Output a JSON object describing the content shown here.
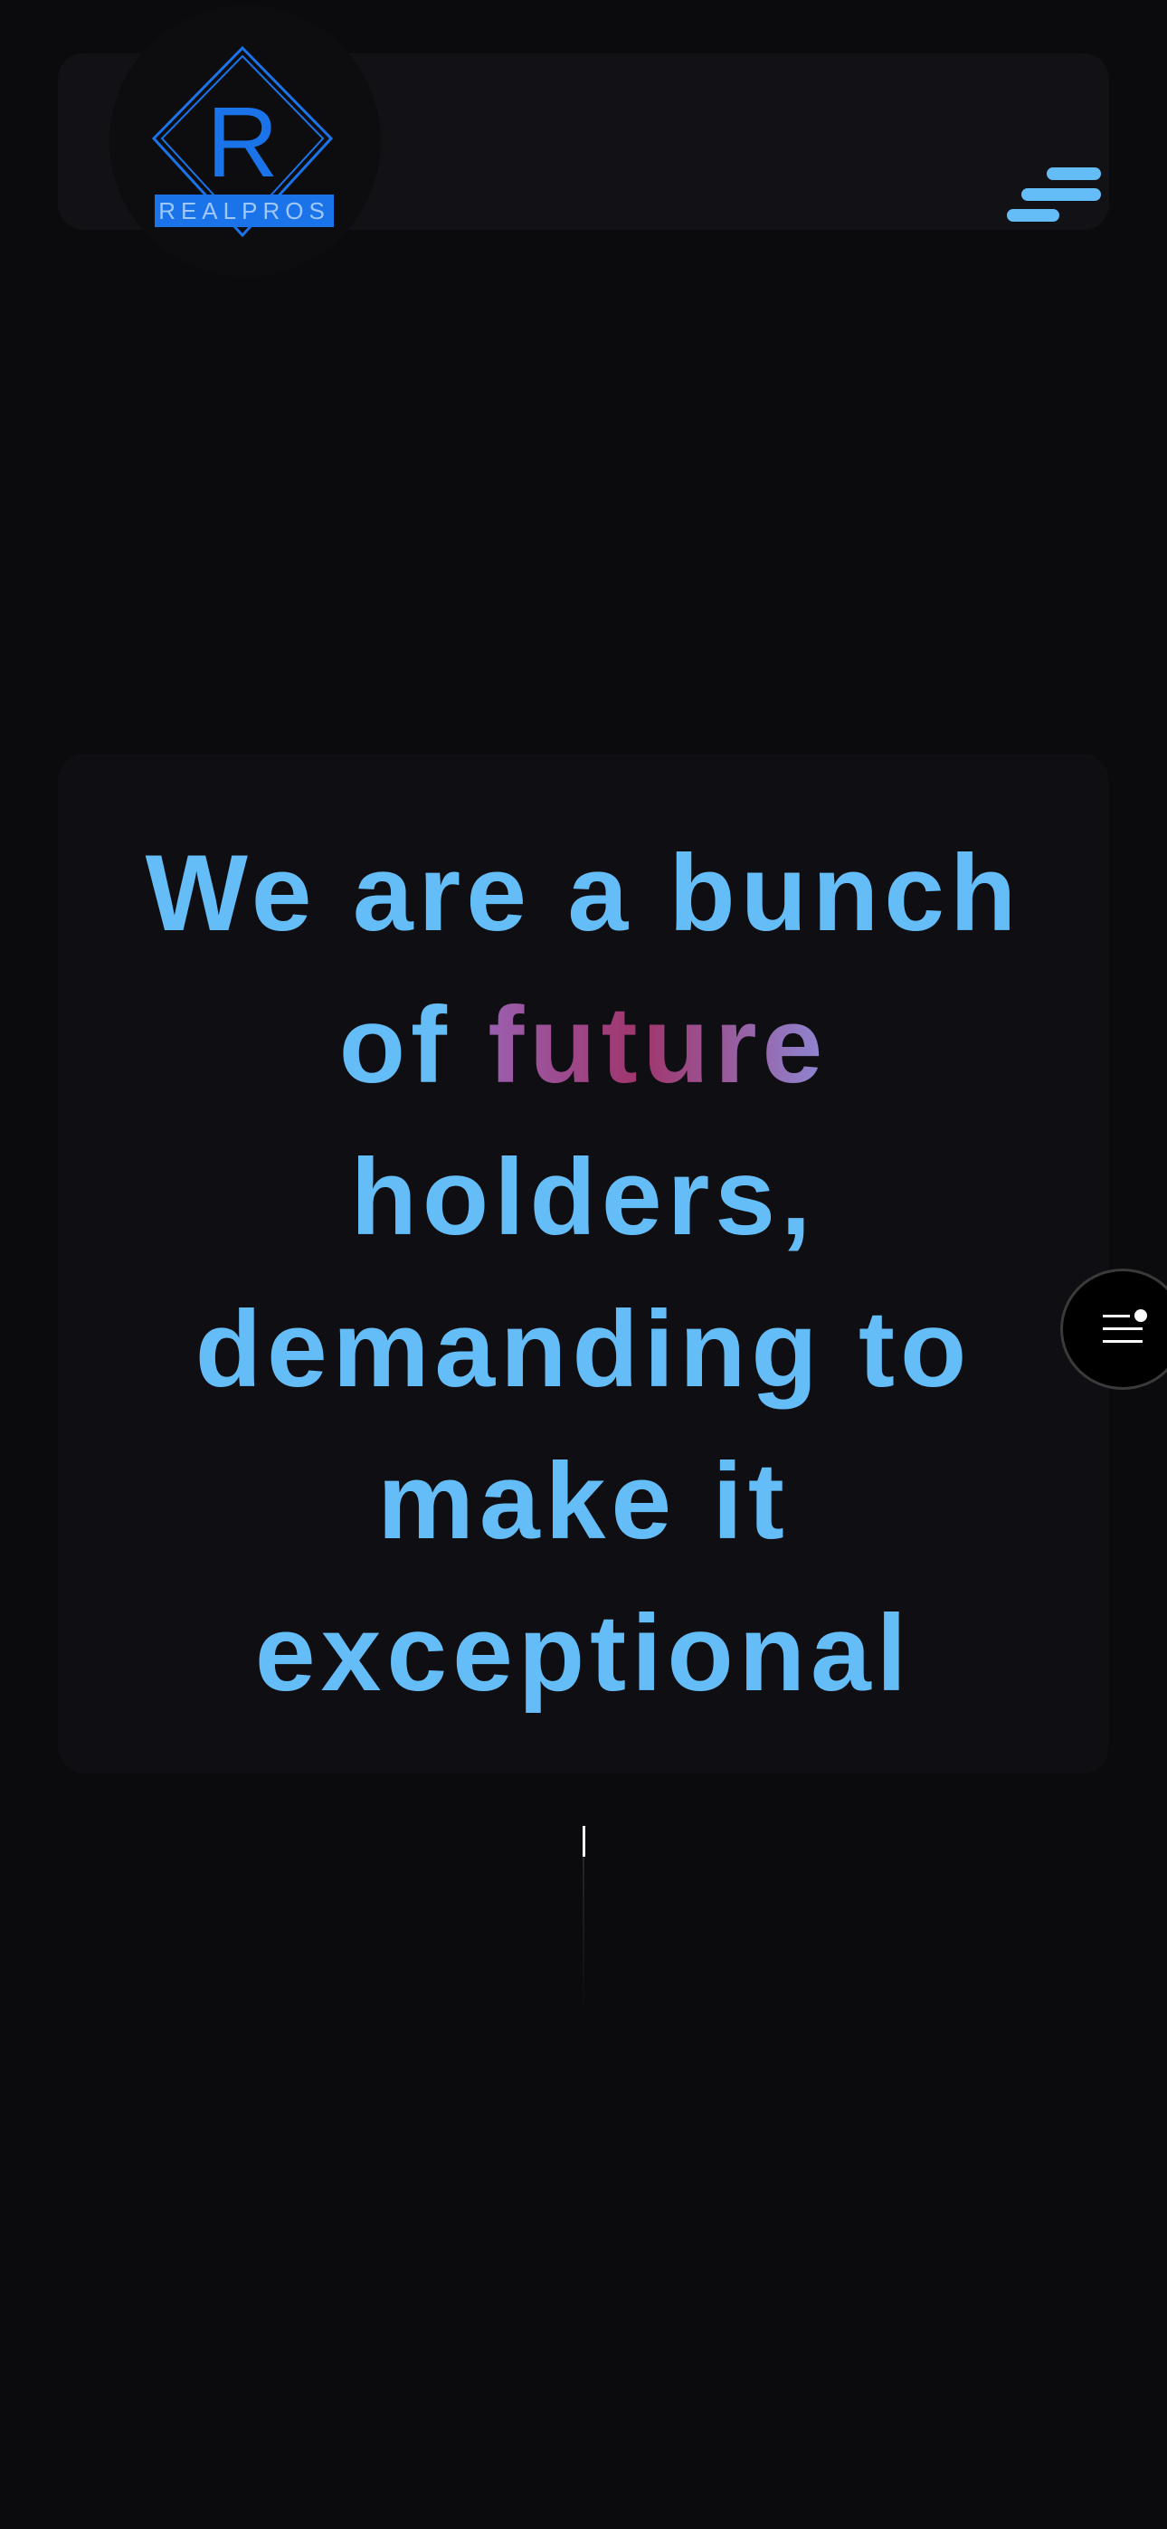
{
  "brand": {
    "logo_letter": "R",
    "logo_wordmark": "REALPROS",
    "logo_color": "#1a73e8"
  },
  "header": {
    "menu_icon": "hamburger-menu-icon"
  },
  "hero": {
    "line1": "We are a bunch",
    "line2_prefix": "of ",
    "line2_highlight": "future",
    "line3": "holders,",
    "line4": "demanding to",
    "line5": "make it",
    "line6": "exceptional",
    "text_color": "#65bdf7"
  },
  "floating_button": {
    "icon": "list-menu-icon"
  }
}
